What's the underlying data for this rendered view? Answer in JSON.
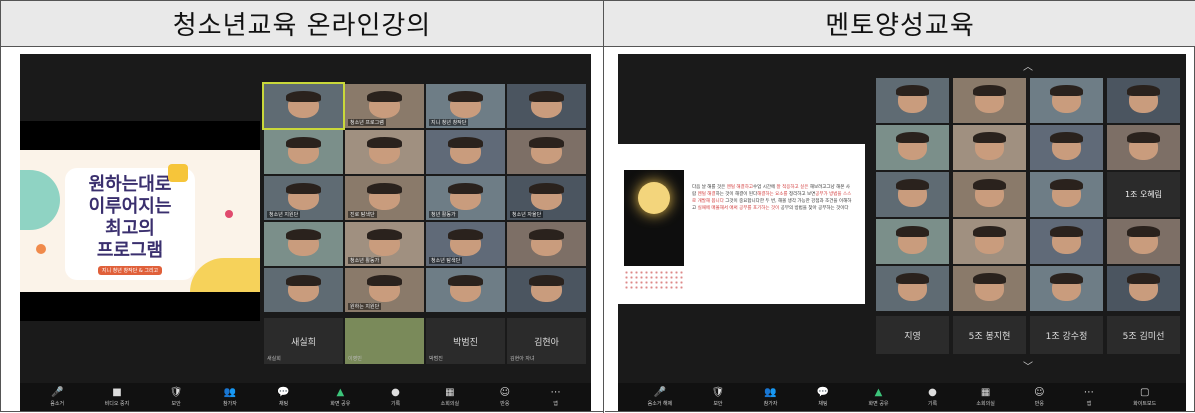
{
  "headers": {
    "left": "청소년교육 온라인강의",
    "right": "멘토양성교육"
  },
  "left": {
    "slide": {
      "title_lines": [
        "원하는대로",
        "이루어지는",
        "최고의",
        "프로그램"
      ],
      "subtitle": "지니 청년 창작단 & 그리고"
    },
    "tiles": [
      {
        "name": "",
        "highlight": true
      },
      {
        "name": "청소년 프로그램"
      },
      {
        "name": "지니 청년 창작단"
      },
      {
        "name": ""
      },
      {
        "name": ""
      },
      {
        "name": ""
      },
      {
        "name": ""
      },
      {
        "name": ""
      },
      {
        "name": "청소년 지원단"
      },
      {
        "name": "진로 탐색단"
      },
      {
        "name": "청년 활동가"
      },
      {
        "name": "청소년 자율단"
      },
      {
        "name": ""
      },
      {
        "name": "청소년 활동가"
      },
      {
        "name": "청소년 탐색단"
      },
      {
        "name": ""
      },
      {
        "name": ""
      },
      {
        "name": "원하는 지원단"
      },
      {
        "name": ""
      },
      {
        "name": ""
      }
    ],
    "names": [
      {
        "label": "새실희",
        "small": "새실희"
      },
      {
        "label": "",
        "small": "이영민",
        "photo": true
      },
      {
        "label": "박범진",
        "small": "박범진"
      },
      {
        "label": "김현아",
        "small": "김현아 자녀"
      }
    ],
    "toolbar": [
      {
        "icon": "🎤",
        "label": "음소거"
      },
      {
        "icon": "■",
        "label": "비디오 중지"
      },
      {
        "icon": "🛡",
        "label": "보안"
      },
      {
        "icon": "👥",
        "label": "참가자"
      },
      {
        "icon": "💬",
        "label": "채팅"
      },
      {
        "icon": "▲",
        "label": "화면 공유",
        "green": true
      },
      {
        "icon": "●",
        "label": "기록"
      },
      {
        "icon": "▦",
        "label": "소회의실"
      },
      {
        "icon": "☺",
        "label": "반응"
      },
      {
        "icon": "⋯",
        "label": "앱"
      }
    ]
  },
  "right": {
    "slide": {
      "lines": [
        {
          "t": "다음 날 해를 것은 "
        },
        {
          "t": "멘털 해결하고",
          "red": true
        },
        {
          "t": "수업 시간에 "
        },
        {
          "t": "잘 적응하고 싶은",
          "red": true
        },
        {
          "t": " 해보려고"
        },
        {
          "t": "그냥 해본 사람 "
        },
        {
          "t": "멘털 해결",
          "red": true
        },
        {
          "t": "하는 것이 해결이 된다"
        },
        {
          "t": "해결하는 요소를 ",
          "red": true
        },
        {
          "t": "정리하고 보면"
        },
        {
          "t": "공부가 방법을 스스로 개발해 봅니다",
          "red": true
        },
        {
          "t": " 그것이 중요합니다"
        },
        {
          "t": "한 두 번, 해볼 생각 가능한 강점과 조건을 이해하고 "
        },
        {
          "t": "실패에 매몰해서 애써 공부를 포기하는 것이",
          "red": true
        },
        {
          "t": " 공부의 방법을 찾아 공부하는 것이다"
        }
      ]
    },
    "tiles": [
      {
        "label": ""
      },
      {
        "label": ""
      },
      {
        "label": ""
      },
      {
        "label": ""
      },
      {
        "label": ""
      },
      {
        "label": ""
      },
      {
        "label": ""
      },
      {
        "label": ""
      },
      {
        "label": ""
      },
      {
        "label": ""
      },
      {
        "label": ""
      },
      {
        "label": "1조 오혜림"
      },
      {
        "label": ""
      },
      {
        "label": ""
      },
      {
        "label": ""
      },
      {
        "label": ""
      },
      {
        "label": ""
      },
      {
        "label": ""
      },
      {
        "label": ""
      },
      {
        "label": ""
      }
    ],
    "names": [
      {
        "label": "지영"
      },
      {
        "label": "5조 봉지현"
      },
      {
        "label": "1조 강수정"
      },
      {
        "label": "5조 김미선"
      }
    ],
    "toolbar": [
      {
        "icon": "🎤",
        "label": "음소거 해제"
      },
      {
        "icon": "🛡",
        "label": "보안"
      },
      {
        "icon": "👥",
        "label": "참가자"
      },
      {
        "icon": "💬",
        "label": "채팅"
      },
      {
        "icon": "▲",
        "label": "화면 공유",
        "green": true
      },
      {
        "icon": "●",
        "label": "기록"
      },
      {
        "icon": "▦",
        "label": "소회의실"
      },
      {
        "icon": "☺",
        "label": "반응"
      },
      {
        "icon": "⋯",
        "label": "앱"
      },
      {
        "icon": "▢",
        "label": "화이트보드"
      }
    ]
  }
}
